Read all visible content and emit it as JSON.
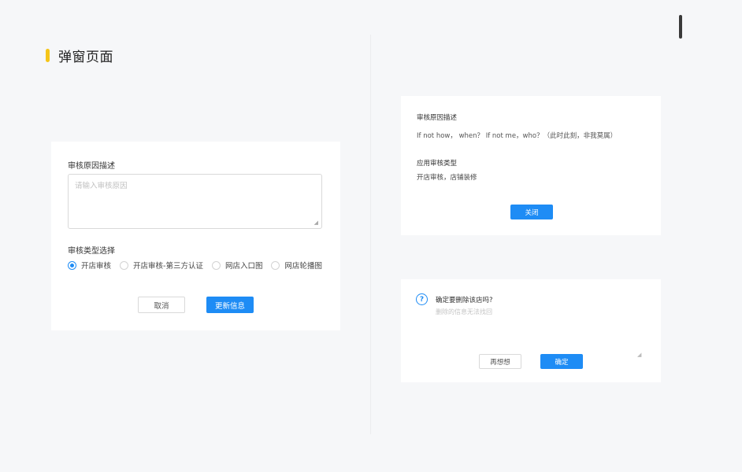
{
  "page": {
    "title": "弹窗页面",
    "accent_color": "#f5c518"
  },
  "icons": {
    "radio_checked": "radio-checked-icon",
    "radio_unchecked": "radio-unchecked-icon",
    "question": "question-circle-icon",
    "resize": "resize-handle-icon"
  },
  "form_modal": {
    "reason_label": "审核原因描述",
    "reason_placeholder": "请输入审核原因",
    "type_label": "审核类型选择",
    "options": [
      {
        "label": "开店审核",
        "checked": true
      },
      {
        "label": "开店审核-第三方认证",
        "checked": false
      },
      {
        "label": "网店入口图",
        "checked": false
      },
      {
        "label": "网店轮播图",
        "checked": false
      }
    ],
    "cancel_label": "取消",
    "submit_label": "更新信息"
  },
  "detail_modal": {
    "reason_label": "审核原因描述",
    "reason_value": "If not how， when？ If not me，who？（此时此刻，非我莫属）",
    "type_label": "应用审核类型",
    "type_value": "开店审核，店铺装修",
    "close_label": "关闭"
  },
  "confirm_modal": {
    "title": "确定要删除该店吗?",
    "subtitle": "删除的信息无法找回",
    "cancel_label": "再想想",
    "ok_label": "确定"
  },
  "colors": {
    "primary": "#1e8cf5",
    "background": "#f6f7f9"
  }
}
